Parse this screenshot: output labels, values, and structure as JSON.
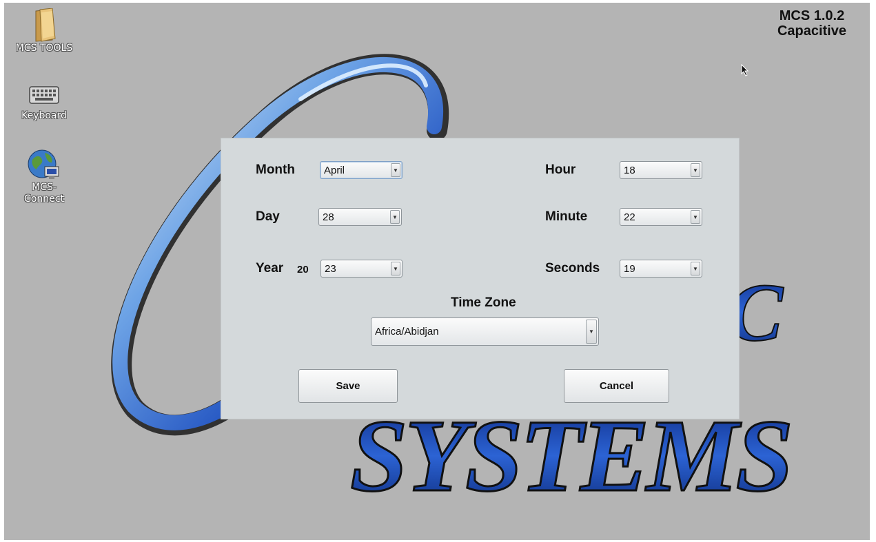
{
  "desktop": {
    "icons": [
      {
        "label": "MCS TOOLS",
        "icon": "folder-icon"
      },
      {
        "label": "Keyboard",
        "icon": "keyboard-icon"
      },
      {
        "label": "MCS-\nConnect",
        "icon": "globe-network-icon"
      }
    ],
    "version_line1": "MCS 1.0.2",
    "version_line2": "Capacitive",
    "wallpaper": {
      "text": "SYSTEMS",
      "letter": "C"
    },
    "cursor_icon": "mouse-pointer-icon"
  },
  "dialog": {
    "month": {
      "label": "Month",
      "value": "April"
    },
    "day": {
      "label": "Day",
      "value": "28"
    },
    "year": {
      "label": "Year",
      "prefix": "20",
      "value": "23"
    },
    "hour": {
      "label": "Hour",
      "value": "18"
    },
    "minute": {
      "label": "Minute",
      "value": "22"
    },
    "seconds": {
      "label": "Seconds",
      "value": "19"
    },
    "timezone": {
      "label": "Time Zone",
      "value": "Africa/Abidjan"
    },
    "save_label": "Save",
    "cancel_label": "Cancel",
    "dropdown_arrow_icon": "chevron-down-icon"
  },
  "colors": {
    "desktop_bg": "#b4b4b4",
    "dialog_bg": "#d4d9db",
    "logo_blue": "#1e4fbf"
  }
}
